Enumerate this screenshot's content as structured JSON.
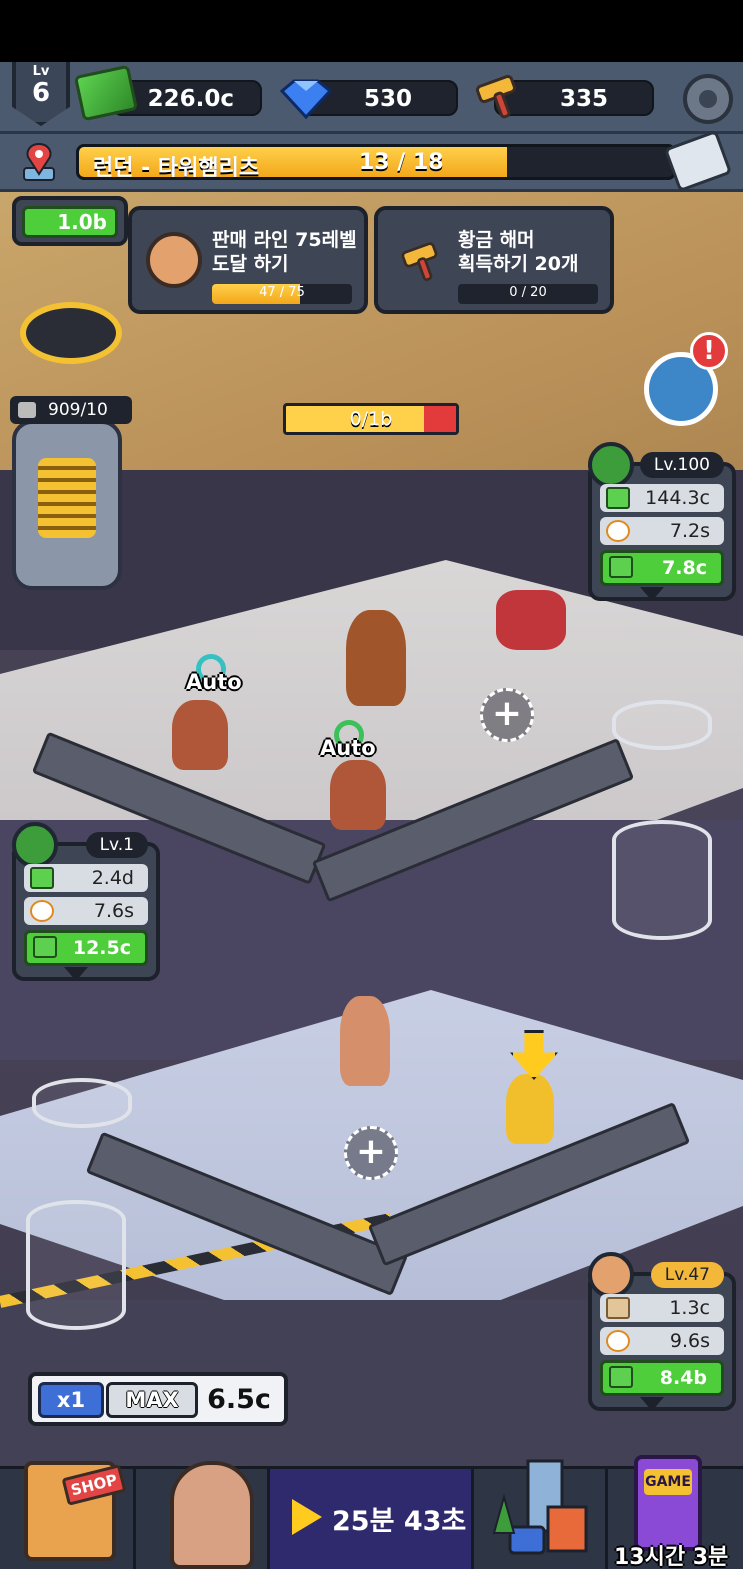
{
  "top_bar": {
    "level_label": "Lv",
    "level_value": "6",
    "cash": "226.0c",
    "gems": "530",
    "hammers": "335",
    "icons": [
      "cash-icon",
      "gem-icon",
      "hammer-icon",
      "gear-icon"
    ]
  },
  "stage": {
    "title": "런던 - 타워햄리츠",
    "progress_text": "13 / 18",
    "progress_fraction": 0.72
  },
  "quests": [
    {
      "line1": "판매 라인 75레벨",
      "line2": "도달 하기",
      "progress_text": "47 / 75",
      "progress_fraction": 0.63,
      "icon": "box-icon"
    },
    {
      "line1": "황금 해머",
      "line2": "획득하기 20개",
      "progress_text": "0 / 20",
      "progress_fraction": 0.0,
      "icon": "golden-hammer-icon"
    }
  ],
  "top_station_cash": "1.0b",
  "bolt_counter": "909/10",
  "center_bar": {
    "text": "0/1b",
    "fill_fraction": 0.83
  },
  "stations": [
    {
      "id": "mine",
      "level": "Lv.100",
      "income": "144.3c",
      "time": "7.2s",
      "upgrade_cost": "7.8c",
      "icon": "dynamite-icon"
    },
    {
      "id": "drill",
      "level": "Lv.1",
      "income": "2.4d",
      "time": "7.6s",
      "upgrade_cost": "12.5c",
      "icon": "drill-icon"
    },
    {
      "id": "sales",
      "level": "Lv.47",
      "income": "1.3c",
      "time": "9.6s",
      "upgrade_cost": "8.4b",
      "icon": "box-icon"
    }
  ],
  "auto_labels": [
    "Auto",
    "Auto"
  ],
  "alert_mark": "!",
  "plus_label": "+",
  "multiplier": {
    "x1": "x1",
    "max": "MAX",
    "value": "6.5c"
  },
  "bottom_nav": {
    "shop_sign": "SHOP",
    "video_timer": "25분 43초",
    "arcade_sign": "GAME",
    "arcade_timer": "13시간 3분"
  },
  "colors": {
    "cash_green": "#4fce3b",
    "gold": "#ffd04a",
    "panel": "#3e4554",
    "alert_red": "#e33b3b"
  }
}
